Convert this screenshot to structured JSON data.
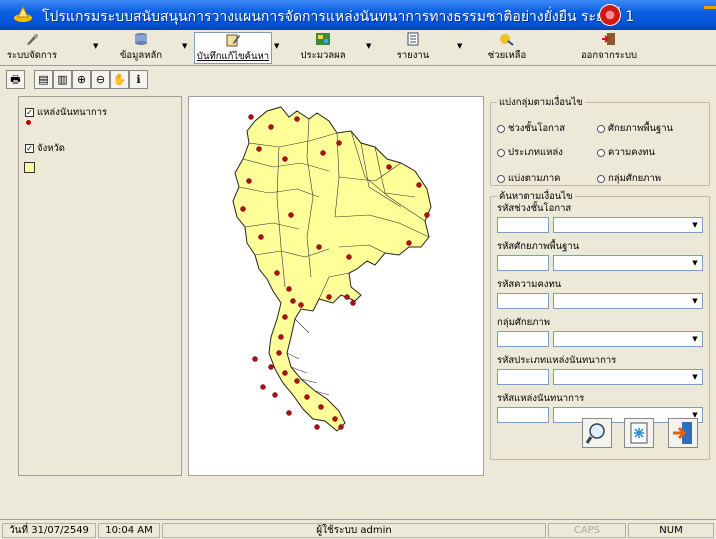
{
  "window": {
    "title": "โปรแกรมระบบสนับสนุนการวางแผนการจัดการแหล่งนันทนาการทางธรรมชาติอย่างยั่งยืน ระยะที่ 1"
  },
  "menu": [
    {
      "label": "ระบบจัดการ",
      "icon": "tools-icon",
      "has_dropdown": true
    },
    {
      "label": "ข้อมูลหลัก",
      "icon": "database-icon",
      "has_dropdown": true
    },
    {
      "label": "บันทึกแก้ไขค้นหา",
      "icon": "edit-icon",
      "has_dropdown": true,
      "active": true
    },
    {
      "label": "ประมวลผล",
      "icon": "process-icon",
      "has_dropdown": true
    },
    {
      "label": "รายงาน",
      "icon": "report-icon",
      "has_dropdown": true
    },
    {
      "label": "ช่วยเหลือ",
      "icon": "help-icon",
      "has_dropdown": false
    },
    {
      "label": "ออกจากระบบ",
      "icon": "logout-icon",
      "has_dropdown": false
    }
  ],
  "map_tools": [
    "print-icon",
    "zoom-extent-icon",
    "zoom-layer-icon",
    "zoom-in-icon",
    "zoom-out-icon",
    "pan-icon",
    "info-icon"
  ],
  "legend": {
    "layers": [
      {
        "label": "แหล่งนันทนาการ",
        "checked": true,
        "symbol": "point",
        "color": "#c00000"
      },
      {
        "label": "จังหวัด",
        "checked": true,
        "symbol": "polygon",
        "color": "#ffff99"
      }
    ]
  },
  "grouping": {
    "title": "แบ่งกลุ่มตามเงื่อนไข",
    "options": [
      "ช่วงชั้นโอกาส",
      "ศักยภาพพื้นฐาน",
      "ประเภทแหล่ง",
      "ความคงทน",
      "แบ่งตามภาค",
      "กลุ่มศักยภาพ"
    ]
  },
  "search": {
    "title": "ค้นหาตามเงื่อนไข",
    "fields": [
      {
        "label": "รหัสช่วงชั้นโอกาส",
        "code": "",
        "value": ""
      },
      {
        "label": "รหัสศักยภาพพื้นฐาน",
        "code": "",
        "value": ""
      },
      {
        "label": "รหัสความคงทน",
        "code": "",
        "value": ""
      },
      {
        "label": "กลุ่มศักยภาพ",
        "code": "",
        "value": ""
      },
      {
        "label": "รหัสประเภทแหล่งนันทนาการ",
        "code": "",
        "value": ""
      },
      {
        "label": "รหัสแหล่งนันทนาการ",
        "code": "",
        "value": ""
      }
    ]
  },
  "actions": [
    "search-icon",
    "clear-icon",
    "exit-icon"
  ],
  "status": {
    "date": "วันที่ 31/07/2549",
    "time": "10:04 AM",
    "user": "ผู้ใช้ระบบ admin",
    "caps": "CAPS",
    "num": "NUM"
  }
}
